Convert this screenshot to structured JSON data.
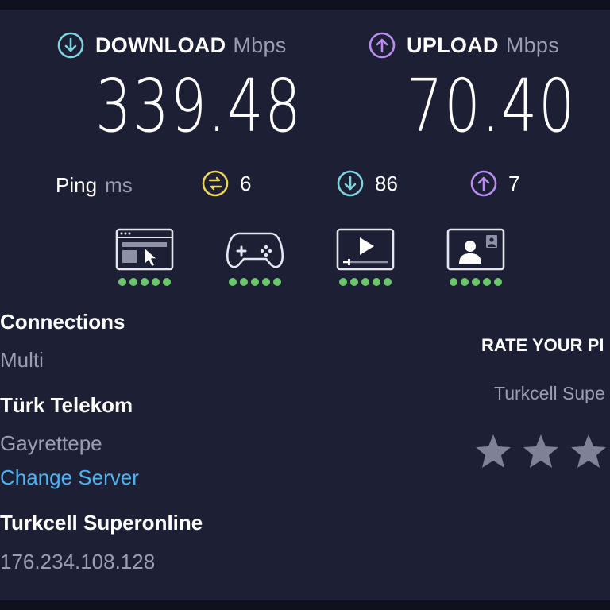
{
  "download": {
    "label": "DOWNLOAD",
    "unit": "Mbps",
    "value": "339.48",
    "icon": "arrow-down-circle-icon",
    "color": "#7ed3dc"
  },
  "upload": {
    "label": "UPLOAD",
    "unit": "Mbps",
    "value": "70.40",
    "icon": "arrow-up-circle-icon",
    "color": "#b98cf0"
  },
  "ping": {
    "label": "Ping",
    "unit": "ms",
    "idle": {
      "value": "6",
      "icon": "latency-icon",
      "color": "#e8d55a"
    },
    "download": {
      "value": "86",
      "icon": "arrow-down-circle-icon",
      "color": "#7ed3dc"
    },
    "upload": {
      "value": "7",
      "icon": "arrow-up-circle-icon",
      "color": "#b98cf0"
    }
  },
  "experience": [
    {
      "icon": "web-browsing-icon",
      "rating": 5
    },
    {
      "icon": "gaming-controller-icon",
      "rating": 5
    },
    {
      "icon": "video-streaming-icon",
      "rating": 5
    },
    {
      "icon": "video-call-icon",
      "rating": 5
    }
  ],
  "info": {
    "connections_label": "Connections",
    "connections_value": "Multi",
    "server_name": "Türk Telekom",
    "server_location": "Gayrettepe",
    "change_server": "Change Server",
    "provider": "Turkcell Superonline",
    "ip": "176.234.108.128"
  },
  "rate": {
    "title": "RATE YOUR PI",
    "provider": "Turkcell Supe",
    "stars_visible": 3
  },
  "colors": {
    "background": "#1d1f34",
    "muted": "#9b9db5",
    "link": "#4fb3f0",
    "good": "#6ac86a"
  }
}
